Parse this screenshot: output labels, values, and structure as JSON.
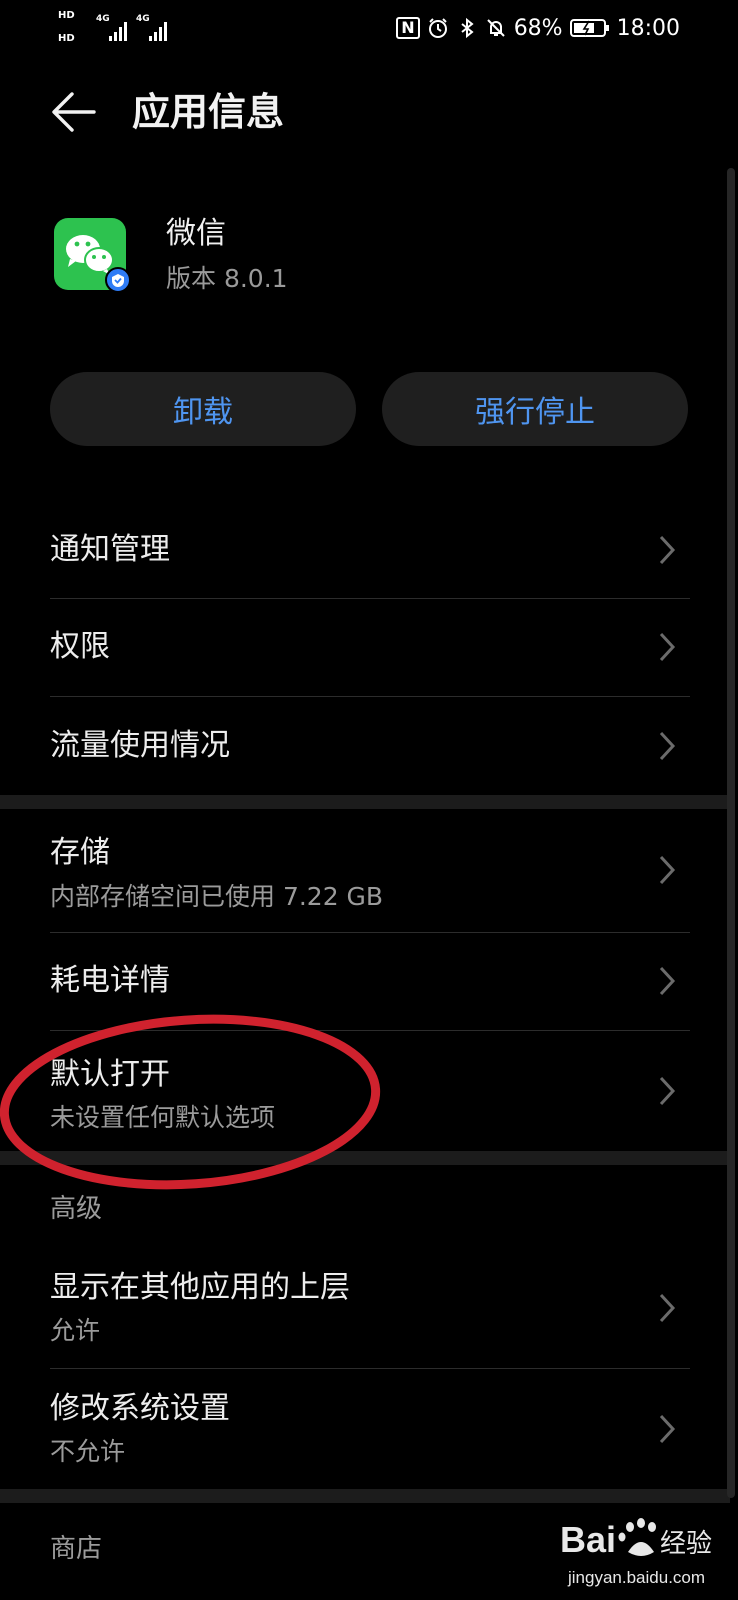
{
  "status_bar": {
    "hd_1": "HD",
    "hd_2": "HD",
    "network_1": "4G",
    "network_2": "4G",
    "nfc": "N",
    "battery_percent": "68%",
    "time": "18:00"
  },
  "header": {
    "title": "应用信息",
    "back_icon": "back-arrow-icon"
  },
  "app": {
    "name": "微信",
    "version": "版本 8.0.1",
    "icon": "wechat-icon",
    "icon_color": "#2DC24F",
    "badge_color": "#2F7CF6"
  },
  "actions": {
    "uninstall": "卸载",
    "force_stop": "强行停止",
    "accent_color": "#4F95F0"
  },
  "groups": {
    "group_1": [
      {
        "title": "通知管理"
      },
      {
        "title": "权限"
      },
      {
        "title": "流量使用情况"
      }
    ],
    "group_2": [
      {
        "title": "存储",
        "subtitle": "内部存储空间已使用 7.22 GB"
      },
      {
        "title": "耗电详情"
      },
      {
        "title": "默认打开",
        "subtitle": "未设置任何默认选项"
      }
    ],
    "advanced": {
      "header": "高级",
      "items": [
        {
          "title": "显示在其他应用的上层",
          "subtitle": "允许"
        },
        {
          "title": "修改系统设置",
          "subtitle": "不允许"
        }
      ]
    },
    "store": {
      "title": "商店"
    }
  },
  "watermark": {
    "brand": "Bai",
    "brand_suffix": "经验",
    "url": "jingyan.baidu.com",
    "brand_color": "#E8E8E8"
  },
  "annotation_color": "#D0222E"
}
